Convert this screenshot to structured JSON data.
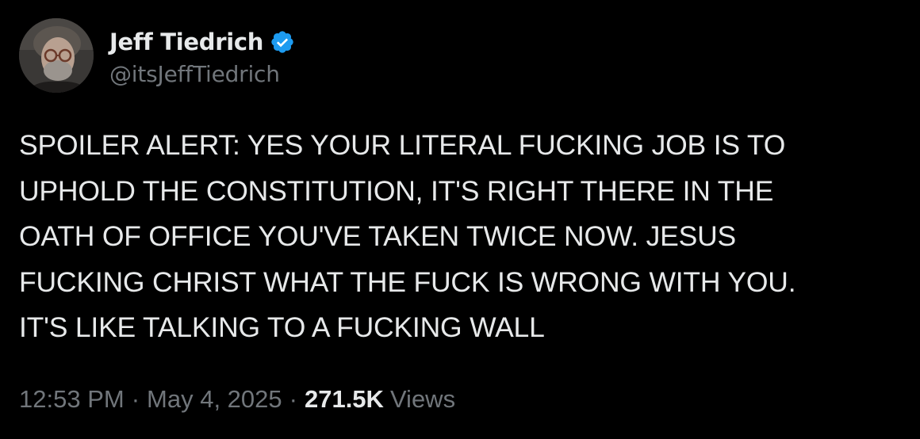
{
  "author": {
    "display_name": "Jeff Tiedrich",
    "handle": "@itsJeffTiedrich",
    "verified": true,
    "verified_badge_color": "#1d9bf0",
    "avatar_icon": "profile-photo"
  },
  "tweet": {
    "text": "SPOILER ALERT: YES YOUR LITERAL FUCKING JOB IS TO\nUPHOLD THE CONSTITUTION, IT'S RIGHT THERE IN THE\nOATH OF OFFICE YOU'VE TAKEN TWICE NOW. JESUS\nFUCKING CHRIST WHAT THE FUCK IS WRONG WITH YOU.\nIT'S LIKE TALKING TO A FUCKING WALL"
  },
  "meta": {
    "time": "12:53 PM",
    "date": "May 4, 2025",
    "separator": "·",
    "views_count": "271.5K",
    "views_label": "Views"
  },
  "colors": {
    "background": "#000000",
    "primary_text": "#e7e9ea",
    "secondary_text": "#71767b"
  }
}
